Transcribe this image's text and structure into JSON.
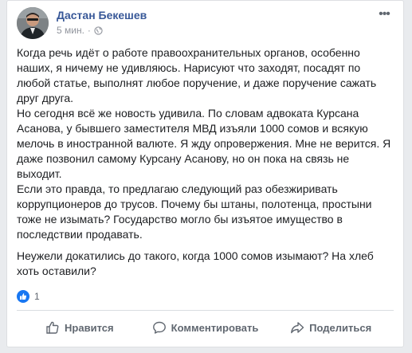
{
  "post": {
    "author": "Дастан Бекешев",
    "time": "5 мин.",
    "separator": "·",
    "paragraphs": [
      "Когда речь идёт о работе правоохранительных органов, особенно наших, я ничему не удивляюсь. Нарисуют что заходят, посадят по любой статье, выполнят любое поручение, и даже поручение сажать друг друга.",
      "Но сегодня всё же новость удивила. По словам адвоката Курсана Асанова, у бывшего заместителя МВД изъяли 1000 сомов и всякую мелочь в иностранной валюте. Я жду опровержения. Мне не верится. Я даже позвонил самому Курсану Асанову, но он пока на связь не выходит.",
      "Если это правда, то предлагаю следующий раз обезжиривать коррупционеров до трусов. Почему бы штаны, полотенца, простыни тоже не изымать? Государство могло бы изъятое имущество в последствии продавать.",
      "Неужели докатились до такого, когда 1000 сомов изымают? На хлеб хоть оставили?"
    ],
    "more_icon": "•••"
  },
  "reactions": {
    "icon": "like-reaction-icon",
    "count": "1"
  },
  "actions": {
    "like": "Нравится",
    "comment": "Комментировать",
    "share": "Поделиться"
  },
  "colors": {
    "author": "#385898",
    "like_blue": "#1877f2",
    "muted": "#606770"
  }
}
